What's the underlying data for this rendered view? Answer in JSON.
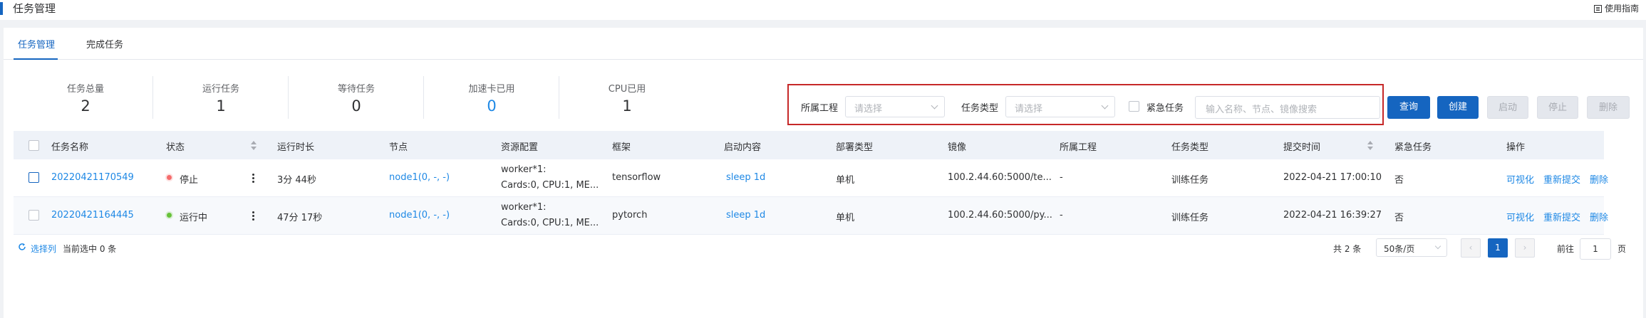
{
  "header": {
    "title": "任务管理",
    "guide_label": "使用指南"
  },
  "tabs": [
    {
      "label": "任务管理"
    },
    {
      "label": "完成任务"
    }
  ],
  "stats": [
    {
      "label": "任务总量",
      "value": "2"
    },
    {
      "label": "运行任务",
      "value": "1"
    },
    {
      "label": "等待任务",
      "value": "0"
    },
    {
      "label": "加速卡已用",
      "value": "0"
    },
    {
      "label": "CPU已用",
      "value": "1"
    }
  ],
  "filters": {
    "project_label": "所属工程",
    "project_placeholder": "请选择",
    "type_label": "任务类型",
    "type_placeholder": "请选择",
    "urgent_label": "紧急任务",
    "search_placeholder": "输入名称、节点、镜像搜索"
  },
  "actions": {
    "query": "查询",
    "create": "创建",
    "start": "启动",
    "stop": "停止",
    "delete": "删除"
  },
  "table": {
    "columns": [
      "任务名称",
      "状态",
      "运行时长",
      "节点",
      "资源配置",
      "框架",
      "启动内容",
      "部署类型",
      "镜像",
      "所属工程",
      "任务类型",
      "提交时间",
      "紧急任务",
      "操作"
    ],
    "rows": [
      {
        "name": "20220421170549",
        "status": "停止",
        "status_color": "#f56c6c",
        "duration": "3分 44秒",
        "node": "node1(0, -, -)",
        "resource_line1": "worker*1:",
        "resource_line2": "Cards:0, CPU:1, ME...",
        "framework": "tensorflow",
        "launch": "sleep 1d",
        "deploy": "单机",
        "image": "100.2.44.60:5000/te...",
        "project": "-",
        "task_type": "训练任务",
        "submit_time": "2022-04-21 17:00:10",
        "urgent": "否",
        "op_visualize": "可视化",
        "op_resubmit": "重新提交",
        "op_delete": "删除"
      },
      {
        "name": "20220421164445",
        "status": "运行中",
        "status_color": "#67c23a",
        "duration": "47分 17秒",
        "node": "node1(0, -, -)",
        "resource_line1": "worker*1:",
        "resource_line2": "Cards:0, CPU:1, ME...",
        "framework": "pytorch",
        "launch": "sleep 1d",
        "deploy": "单机",
        "image": "100.2.44.60:5000/py...",
        "project": "-",
        "task_type": "训练任务",
        "submit_time": "2022-04-21 16:39:27",
        "urgent": "否",
        "op_visualize": "可视化",
        "op_resubmit": "重新提交",
        "op_delete": "删除"
      }
    ]
  },
  "footer": {
    "select_columns": "选择列",
    "selected_info": "当前选中 0 条",
    "total": "共 2 条",
    "page_size": "50条/页",
    "current_page": "1",
    "goto_prefix": "前往",
    "goto_value": "1",
    "goto_suffix": "页"
  }
}
